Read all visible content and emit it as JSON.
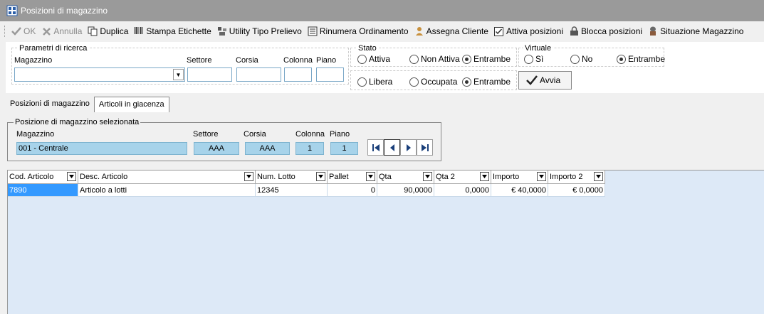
{
  "window": {
    "title": "Posizioni di magazzino"
  },
  "toolbar": {
    "items": [
      {
        "label": "OK",
        "icon": "check-icon",
        "enabled": false
      },
      {
        "label": "Annulla",
        "icon": "cross-icon",
        "enabled": false
      },
      {
        "label": "Duplica",
        "icon": "copy-icon",
        "enabled": true
      },
      {
        "label": "Stampa Etichette",
        "icon": "barcode-icon",
        "enabled": true
      },
      {
        "label": "Utility Tipo Prelievo",
        "icon": "utility-icon",
        "enabled": true
      },
      {
        "label": "Rinumera Ordinamento",
        "icon": "renumber-icon",
        "enabled": true
      },
      {
        "label": "Assegna Cliente",
        "icon": "person-icon",
        "enabled": true
      },
      {
        "label": "Attiva posizioni",
        "icon": "checkbox-icon",
        "enabled": true
      },
      {
        "label": "Blocca posizioni",
        "icon": "lock-icon",
        "enabled": true
      },
      {
        "label": "Situazione Magazzino",
        "icon": "warehouse-icon",
        "enabled": true
      }
    ]
  },
  "search": {
    "group_label": "Parametri di ricerca",
    "magazzino_label": "Magazzino",
    "magazzino_value": "",
    "settore_label": "Settore",
    "corsia_label": "Corsia",
    "colonna_label": "Colonna",
    "piano_label": "Piano"
  },
  "stato": {
    "label": "Stato",
    "row1": [
      {
        "label": "Attiva",
        "checked": false
      },
      {
        "label": "Non Attiva",
        "checked": false
      },
      {
        "label": "Entrambe",
        "checked": true
      }
    ],
    "row2": [
      {
        "label": "Libera",
        "checked": false
      },
      {
        "label": "Occupata",
        "checked": false
      },
      {
        "label": "Entrambe",
        "checked": true
      }
    ]
  },
  "virtuale": {
    "label": "Virtuale",
    "options": [
      {
        "label": "Sì",
        "checked": false
      },
      {
        "label": "No",
        "checked": false
      },
      {
        "label": "Entrambe",
        "checked": true
      }
    ]
  },
  "avvia_label": "Avvia",
  "tabs": [
    {
      "label": "Posizioni di magazzino",
      "active": false
    },
    {
      "label": "Articoli in giacenza",
      "active": true
    }
  ],
  "selected": {
    "group_label": "Posizione di magazzino selezionata",
    "magazzino_label": "Magazzino",
    "magazzino": "001 - Centrale",
    "settore_label": "Settore",
    "settore": "AAA",
    "corsia_label": "Corsia",
    "corsia": "AAA",
    "colonna_label": "Colonna",
    "colonna": "1",
    "piano_label": "Piano",
    "piano": "1"
  },
  "grid": {
    "columns": [
      "Cod. Articolo",
      "Desc. Articolo",
      "Num. Lotto",
      "Pallet",
      "Qta",
      "Qta 2",
      "Importo",
      "Importo 2"
    ],
    "rows": [
      [
        "7890",
        "Articolo a lotti",
        "12345",
        "0",
        "90,0000",
        "0,0000",
        "€ 40,0000",
        "€ 0,0000"
      ]
    ]
  },
  "colors": {
    "titlebar": "#9a9a9a",
    "selected_field": "#a7d3ea",
    "grid_bg": "#dde9f7",
    "selection": "#3399ff"
  }
}
